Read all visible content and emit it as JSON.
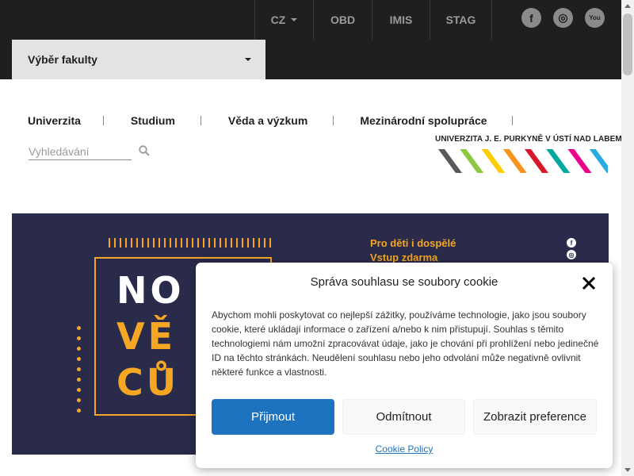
{
  "topnav": {
    "language": "CZ",
    "links": [
      "OBD",
      "IMIS",
      "STAG"
    ],
    "social": {
      "facebook": "f",
      "instagram": "◎",
      "youtube": "You"
    }
  },
  "faculty": {
    "label": "Výběr fakulty"
  },
  "mainnav": {
    "items": [
      "Univerzita",
      "Studium",
      "Věda a výzkum",
      "Mezinárodní spolupráce"
    ]
  },
  "search": {
    "placeholder": "Vyhledávání"
  },
  "brand": {
    "name": "UNIVERZITA J. E. PURKYNĚ V ÚSTÍ NAD LABEM",
    "stripe_colors": [
      "#58595b",
      "#8dc63f",
      "#ffcc00",
      "#f7941d",
      "#d7182a",
      "#00a99d",
      "#ec008c",
      "#29abe2"
    ]
  },
  "banner": {
    "tagline_1": "Pro děti i dospělé",
    "tagline_2": "Vstup zdarma",
    "word_1": "NO",
    "word_2": "VĚ",
    "word_3": "CŮ",
    "accent": "#f5a623"
  },
  "cookie": {
    "title": "Správa souhlasu se soubory cookie",
    "text": "Abychom mohli poskytovat co nejlepší zážitky, používáme technologie, jako jsou soubory cookie, které ukládají informace o zařízení a/nebo k nim přistupují. Souhlas s těmito technologiemi nám umožní zpracovávat údaje, jako je chování při prohlížení nebo jedinečné ID na těchto stránkách. Neudělení souhlasu nebo jeho odvolání může negativně ovlivnit některé funkce a vlastnosti.",
    "accept": "Přijmout",
    "deny": "Odmítnout",
    "preferences": "Zobrazit preference",
    "policy": "Cookie Policy"
  }
}
